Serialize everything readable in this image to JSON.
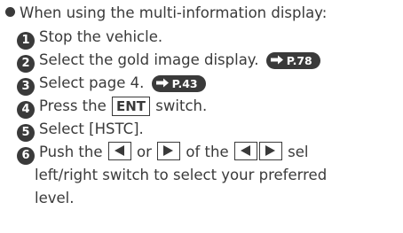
{
  "heading": "When using the multi-information display:",
  "steps": [
    {
      "num": "1",
      "text": "Stop the vehicle."
    },
    {
      "num": "2",
      "text": "Select the gold image display.",
      "ref": "P.78"
    },
    {
      "num": "3",
      "text": "Select page 4.",
      "ref": "P.43"
    },
    {
      "num": "4",
      "pre": "Press the",
      "key": "ENT",
      "post": "switch."
    },
    {
      "num": "5",
      "text": "Select [HSTC]."
    },
    {
      "num": "6",
      "pre": "Push the",
      "mid1": "or",
      "mid2": "of the",
      "post": "sel",
      "line2": "left/right switch to select your preferred",
      "line3": "level."
    }
  ],
  "icons": {
    "ref_arrow": "arrow-right-icon",
    "left_switch": "triangle-left-icon",
    "right_switch": "triangle-right-icon"
  }
}
